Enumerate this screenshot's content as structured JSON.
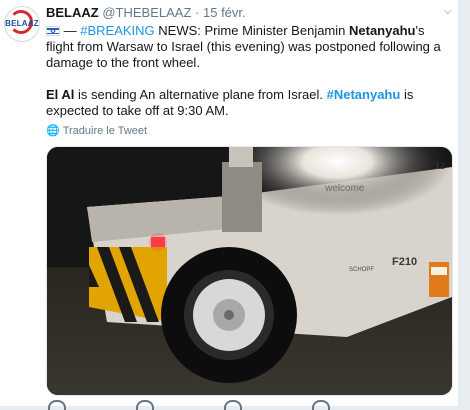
{
  "tweet": {
    "display_name": "BELAAZ",
    "handle": "@THEBELAAZ",
    "separator": "·",
    "date": "15 févr.",
    "avatar_text": "BELAAZ",
    "dash": "—",
    "hashtag_breaking": "#BREAKING",
    "text_part1": " NEWS: Prime Minister Benjamin ",
    "name_bold": "Netanyahu",
    "text_part2": "'s flight from Warsaw to Israel (this evening) was postponed  following a damage to the front wheel.",
    "el_al": "El Al",
    "text_part3": " is sending An alternative  plane from Israel. ",
    "hashtag_netanyahu": "#Netanyahu",
    "text_part4": " is expected to take off at 9:30 AM.",
    "translate_label": "Traduire le Tweet"
  },
  "media": {
    "icons": [
      "photo-of-aircraft-front-wheel-on-tug"
    ],
    "visible_text": {
      "welcome": "welcome",
      "code": "F210",
      "brand": "SCHOPF",
      "number": "12"
    }
  },
  "colors": {
    "link": "#1b95e0",
    "text": "#14171a",
    "muted": "#657786",
    "brand_red": "#d8282f"
  }
}
